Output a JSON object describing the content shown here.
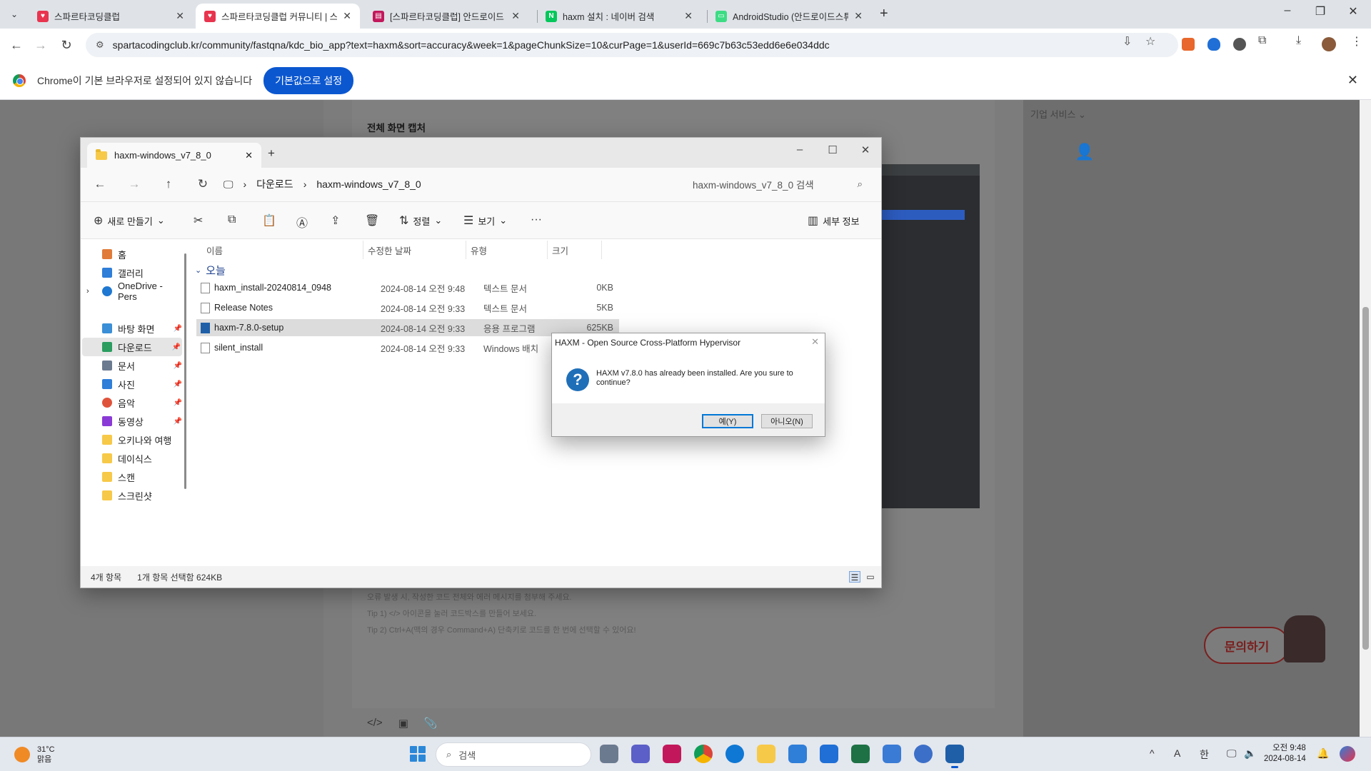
{
  "browser": {
    "tabs": [
      {
        "title": "스파르타코딩클럽",
        "favicon_color": "#e8344e"
      },
      {
        "title": "스파르타코딩클럽 커뮤니티 | 스",
        "favicon_color": "#e8344e"
      },
      {
        "title": "[스파르타코딩클럽] 안드로이드",
        "favicon_color": "#c2185b"
      },
      {
        "title": "haxm 설치 : 네이버 검색",
        "favicon_color": "#03c75a"
      },
      {
        "title": "AndroidStudio (안드로이드스튜",
        "favicon_color": "#3ddc84"
      }
    ],
    "active_tab": 1,
    "url": "spartacodingclub.kr/community/fastqna/kdc_bio_app?text=haxm&sort=accuracy&week=1&pageChunkSize=10&curPage=1&userId=669c7b63c53edd6e6e034ddc"
  },
  "infobar": {
    "message": "Chrome이 기본 브라우저로 설정되어 있지 않습니다",
    "button": "기본값으로 설정"
  },
  "webpage": {
    "heading": "전체 화면 캡처",
    "corp_link": "기업 서비스",
    "hints": [
      "오류 발생 시, 작성한 코드 전체와 에러 메시지를 첨부해 주세요.",
      "Tip 1) </> 아이콘을 눌러 코드박스를 만들어 보세요.",
      "Tip 2) Ctrl+A(맥의 경우 Command+A) 단축키로 코드를 한 번에 선택할 수 있어요!"
    ],
    "inquiry_button": "문의하기"
  },
  "explorer": {
    "tab_title": "haxm-windows_v7_8_0",
    "breadcrumb": [
      "다운로드",
      "haxm-windows_v7_8_0"
    ],
    "search_placeholder": "haxm-windows_v7_8_0 검색",
    "commands": {
      "new": "새로 만들기",
      "sort": "정렬",
      "view": "보기",
      "details": "세부 정보"
    },
    "sidebar": [
      {
        "label": "홈",
        "icon": "home-icon",
        "color": "#e07b39"
      },
      {
        "label": "갤러리",
        "icon": "gallery-icon",
        "color": "#2f7ed8"
      },
      {
        "label": "OneDrive - Pers",
        "icon": "onedrive-icon",
        "color": "#1f78d1"
      },
      {
        "label": "바탕 화면",
        "icon": "desktop-icon",
        "color": "#3a8fd6"
      },
      {
        "label": "다운로드",
        "icon": "download-icon",
        "color": "#2a9d5f"
      },
      {
        "label": "문서",
        "icon": "document-icon",
        "color": "#6b7a8f"
      },
      {
        "label": "사진",
        "icon": "pictures-icon",
        "color": "#2f7ed8"
      },
      {
        "label": "음악",
        "icon": "music-icon",
        "color": "#e0533b"
      },
      {
        "label": "동영상",
        "icon": "videos-icon",
        "color": "#8a3ad6"
      },
      {
        "label": "오키나와 여행",
        "icon": "folder-icon",
        "color": "#f7c948"
      },
      {
        "label": "데이식스",
        "icon": "folder-icon",
        "color": "#f7c948"
      },
      {
        "label": "스캔",
        "icon": "folder-icon",
        "color": "#f7c948"
      },
      {
        "label": "스크린샷",
        "icon": "folder-icon",
        "color": "#f7c948"
      }
    ],
    "columns": [
      "이름",
      "수정한 날짜",
      "유형",
      "크기"
    ],
    "group": "오늘",
    "files": [
      {
        "name": "haxm_install-20240814_0948",
        "date": "2024-08-14 오전 9:48",
        "type": "텍스트 문서",
        "size": "0KB"
      },
      {
        "name": "Release Notes",
        "date": "2024-08-14 오전 9:33",
        "type": "텍스트 문서",
        "size": "5KB"
      },
      {
        "name": "haxm-7.8.0-setup",
        "date": "2024-08-14 오전 9:33",
        "type": "응용 프로그램",
        "size": "625KB"
      },
      {
        "name": "silent_install",
        "date": "2024-08-14 오전 9:33",
        "type": "Windows 배치",
        "size": ""
      }
    ],
    "selected_file": 2,
    "status_count": "4개 항목",
    "status_selected": "1개 항목 선택함 624KB"
  },
  "dialog": {
    "title": "HAXM - Open Source Cross-Platform Hypervisor",
    "message": "HAXM v7.8.0 has already been installed. Are you sure to continue?",
    "yes": "예(Y)",
    "no": "아니오(N)"
  },
  "taskbar": {
    "temperature": "31°C",
    "weather": "맑음",
    "search": "검색",
    "time": "오전 9:48",
    "date": "2024-08-14",
    "ime_a": "A",
    "ime_han": "한"
  }
}
